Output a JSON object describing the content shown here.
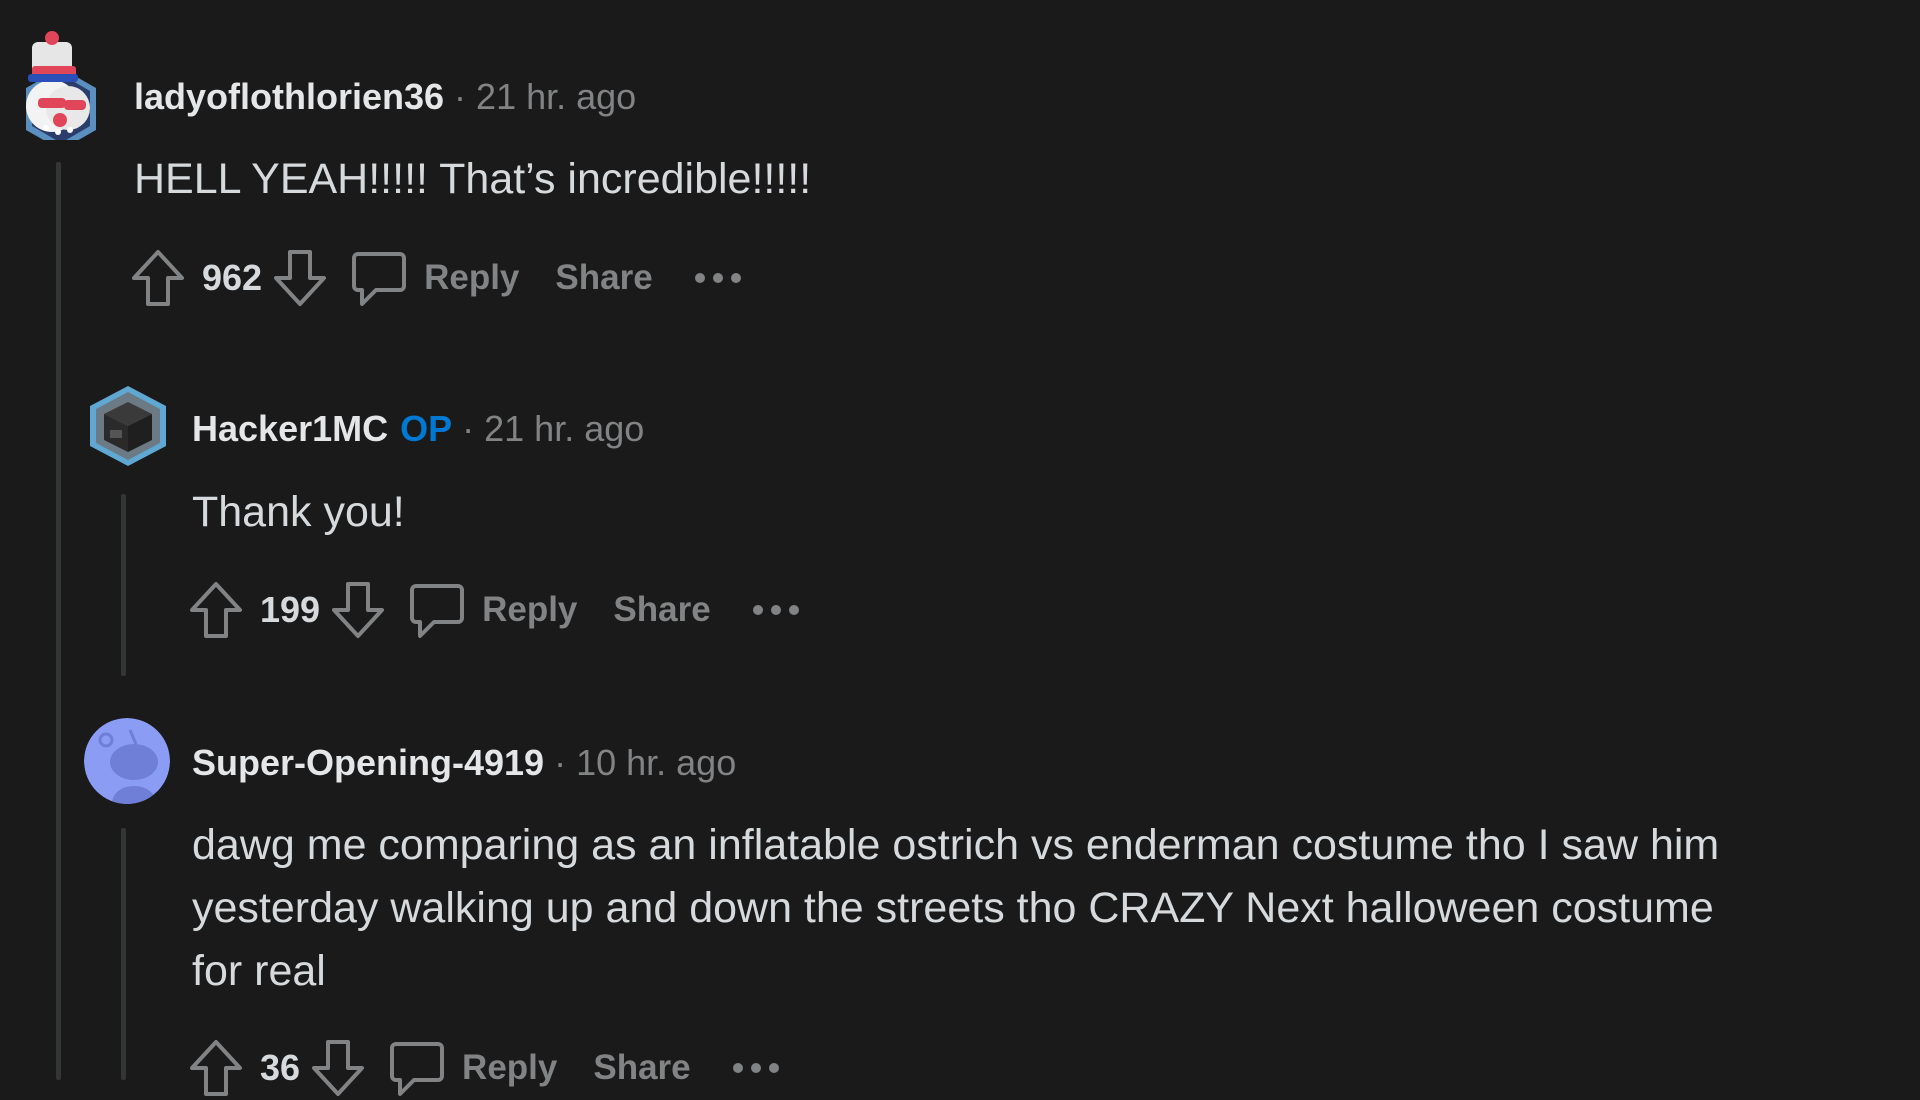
{
  "comments": [
    {
      "username": "ladyoflothlorien36",
      "op_badge": "",
      "separator": "·",
      "timestamp": "21 hr. ago",
      "body": "HELL YEAH!!!!! That’s incredible!!!!!",
      "votes": "962",
      "reply_label": "Reply",
      "share_label": "Share",
      "more_icon": "ellipsis-icon"
    },
    {
      "username": "Hacker1MC",
      "op_badge": "OP",
      "separator": "·",
      "timestamp": "21 hr. ago",
      "body": "Thank you!",
      "votes": "199",
      "reply_label": "Reply",
      "share_label": "Share",
      "more_icon": "ellipsis-icon"
    },
    {
      "username": "Super-Opening-4919",
      "op_badge": "",
      "separator": "·",
      "timestamp": "10 hr. ago",
      "body": "dawg me comparing as an inflatable ostrich vs enderman costume tho I saw him yesterday walking up and down the streets tho CRAZY Next halloween costume for real",
      "votes": "36",
      "reply_label": "Reply",
      "share_label": "Share",
      "more_icon": "ellipsis-icon"
    }
  ],
  "colors": {
    "background": "#1a1a1b",
    "text": "#d7dadc",
    "muted": "#818384",
    "op_blue": "#0079d3",
    "thread_line": "#343536"
  }
}
